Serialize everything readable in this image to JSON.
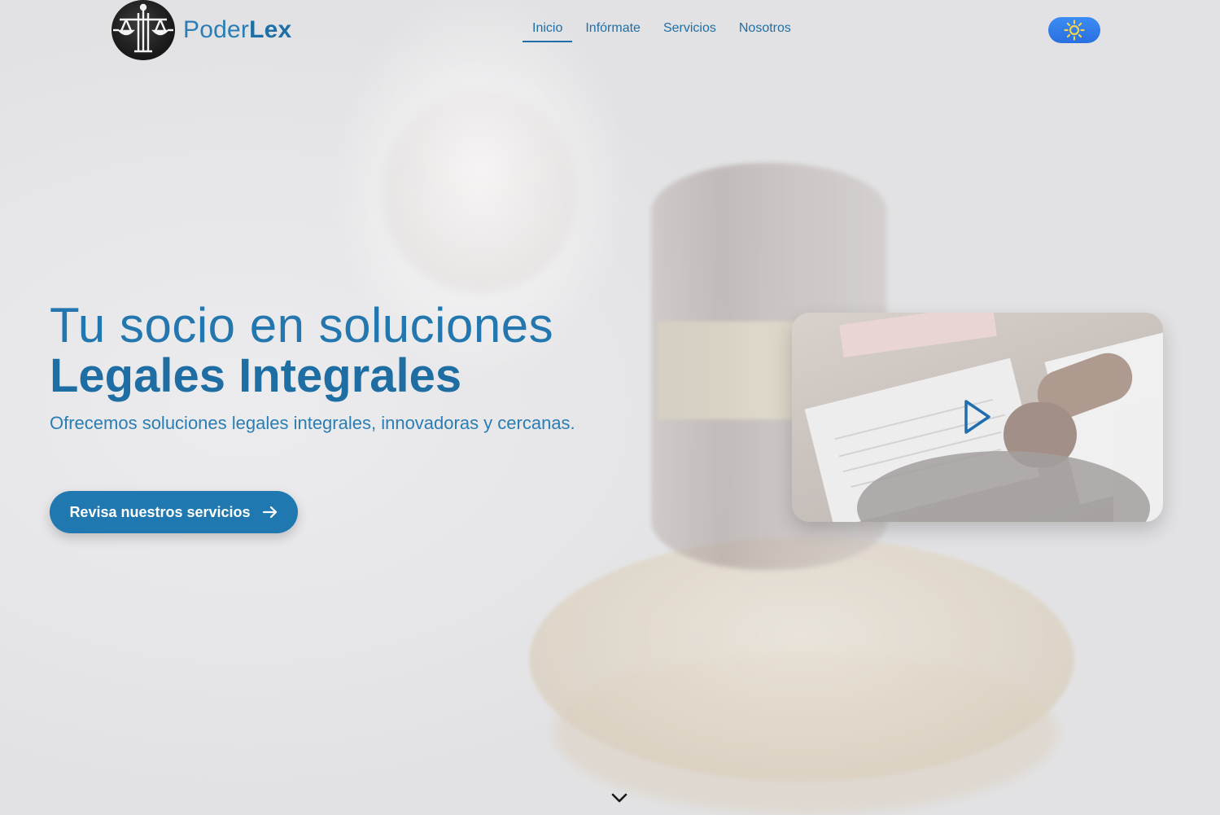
{
  "header": {
    "logo_icon": "scales-of-justice-icon",
    "brand_light": "Poder",
    "brand_bold": "Lex",
    "nav": [
      {
        "label": "Inicio",
        "active": true
      },
      {
        "label": "Infórmate",
        "active": false
      },
      {
        "label": "Servicios",
        "active": false
      },
      {
        "label": "Nosotros",
        "active": false
      }
    ],
    "theme_toggle_icon": "sun-icon"
  },
  "hero": {
    "title_line1": "Tu socio en soluciones",
    "title_line2": "Legales Integrales",
    "subtitle": "Ofrecemos soluciones legales integrales, innovadoras y cercanas.",
    "cta_label": "Revisa nuestros servicios",
    "cta_icon": "arrow-right-icon"
  },
  "video": {
    "play_icon": "play-icon"
  },
  "scroll_icon": "chevron-down-icon",
  "colors": {
    "primary": "#1f78b0",
    "text_blue": "#2a7db5",
    "toggle": "#2f7ae8",
    "sun": "#f5d547"
  }
}
